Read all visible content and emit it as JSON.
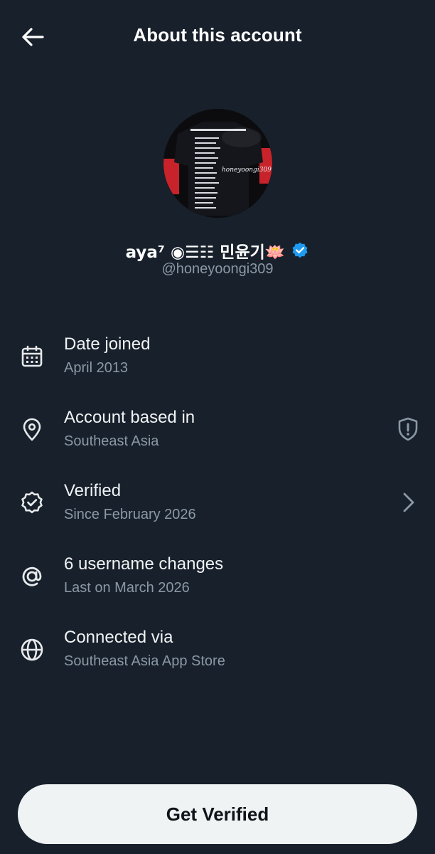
{
  "header": {
    "title": "About this account",
    "back_icon": "arrow-left-icon"
  },
  "profile": {
    "display_name": "aya⁷ ◉☰☷ 민윤기🪷",
    "handle": "@honeyoongi309",
    "avatar_overlay_text": "honeyoongi309",
    "verified_color": "#1d9bf0"
  },
  "details": [
    {
      "icon": "calendar-icon",
      "title": "Date joined",
      "subtitle": "April 2013"
    },
    {
      "icon": "location-pin-icon",
      "title": "Account based in",
      "subtitle": "Southeast Asia"
    },
    {
      "icon": "verified-check-icon",
      "title": "Verified",
      "subtitle": "Since February 2026"
    },
    {
      "icon": "at-sign-icon",
      "title": "6 username changes",
      "subtitle": "Last on March 2026"
    },
    {
      "icon": "globe-icon",
      "title": "Connected via",
      "subtitle": "Southeast Asia App Store"
    }
  ],
  "actions": {
    "get_verified_label": "Get Verified"
  },
  "colors": {
    "background": "#17202b",
    "text_primary": "#e7e9ea",
    "text_secondary": "#8b98a5",
    "button_bg": "#eff3f4"
  }
}
